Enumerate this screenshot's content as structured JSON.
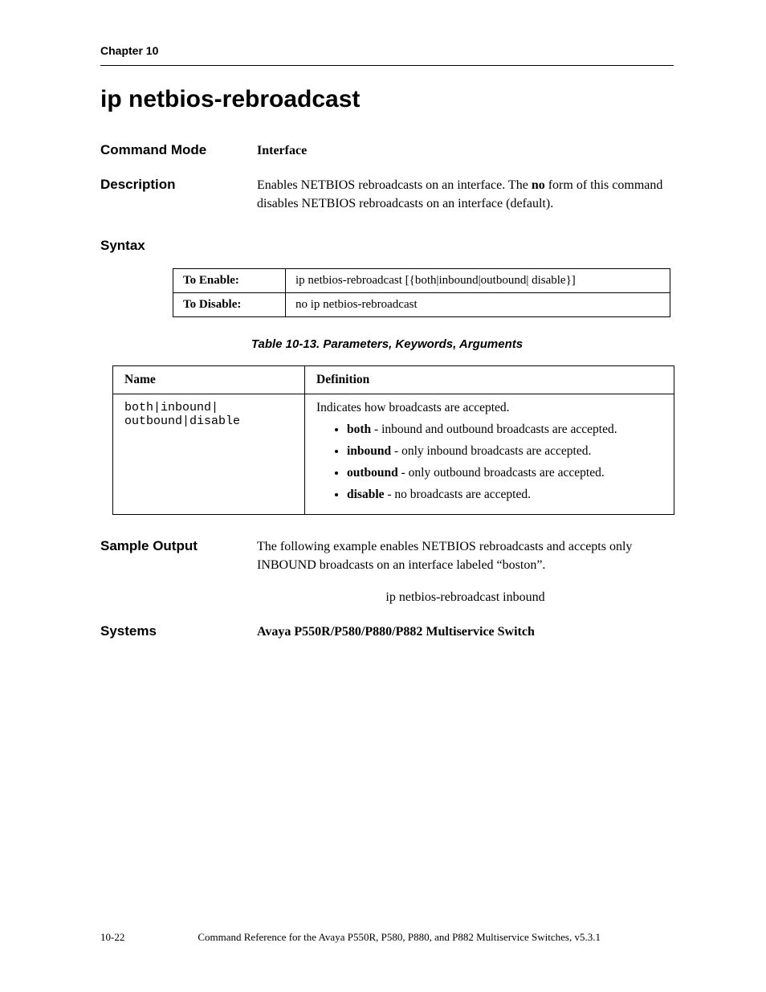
{
  "header": {
    "chapter": "Chapter 10"
  },
  "title": "ip netbios-rebroadcast",
  "command_mode": {
    "label": "Command Mode",
    "value": "Interface"
  },
  "description": {
    "label": "Description",
    "pre": "Enables NETBIOS rebroadcasts on an interface. The ",
    "bold": "no",
    "post": " form of this command disables NETBIOS rebroadcasts on an interface (default)."
  },
  "syntax": {
    "label": "Syntax",
    "rows": [
      {
        "k": "To Enable:",
        "v": "ip netbios-rebroadcast [{both|inbound|outbound| disable}]"
      },
      {
        "k": "To Disable:",
        "v": "no ip netbios-rebroadcast"
      }
    ]
  },
  "table_caption": "Table 10-13.  Parameters, Keywords, Arguments",
  "params": {
    "head": {
      "name": "Name",
      "def": "Definition"
    },
    "row": {
      "name_line1": "both|inbound|",
      "name_line2": "outbound|disable",
      "def_intro": "Indicates how broadcasts are accepted.",
      "items": [
        {
          "b": "both",
          "t": " - inbound and outbound broadcasts are accepted."
        },
        {
          "b": "inbound",
          "t": " - only inbound broadcasts are accepted."
        },
        {
          "b": "outbound",
          "t": " - only outbound broadcasts are accepted."
        },
        {
          "b": "disable",
          "t": " - no broadcasts are accepted."
        }
      ]
    }
  },
  "sample": {
    "label": "Sample Output",
    "text": "The following example enables NETBIOS rebroadcasts and accepts only INBOUND broadcasts on an interface labeled “boston”.",
    "cmd": "ip netbios-rebroadcast inbound"
  },
  "systems": {
    "label": "Systems",
    "value": "Avaya P550R/P580/P880/P882 Multiservice Switch"
  },
  "footer": {
    "page": "10-22",
    "title": "Command Reference for the Avaya P550R, P580, P880, and P882 Multiservice Switches, v5.3.1"
  }
}
